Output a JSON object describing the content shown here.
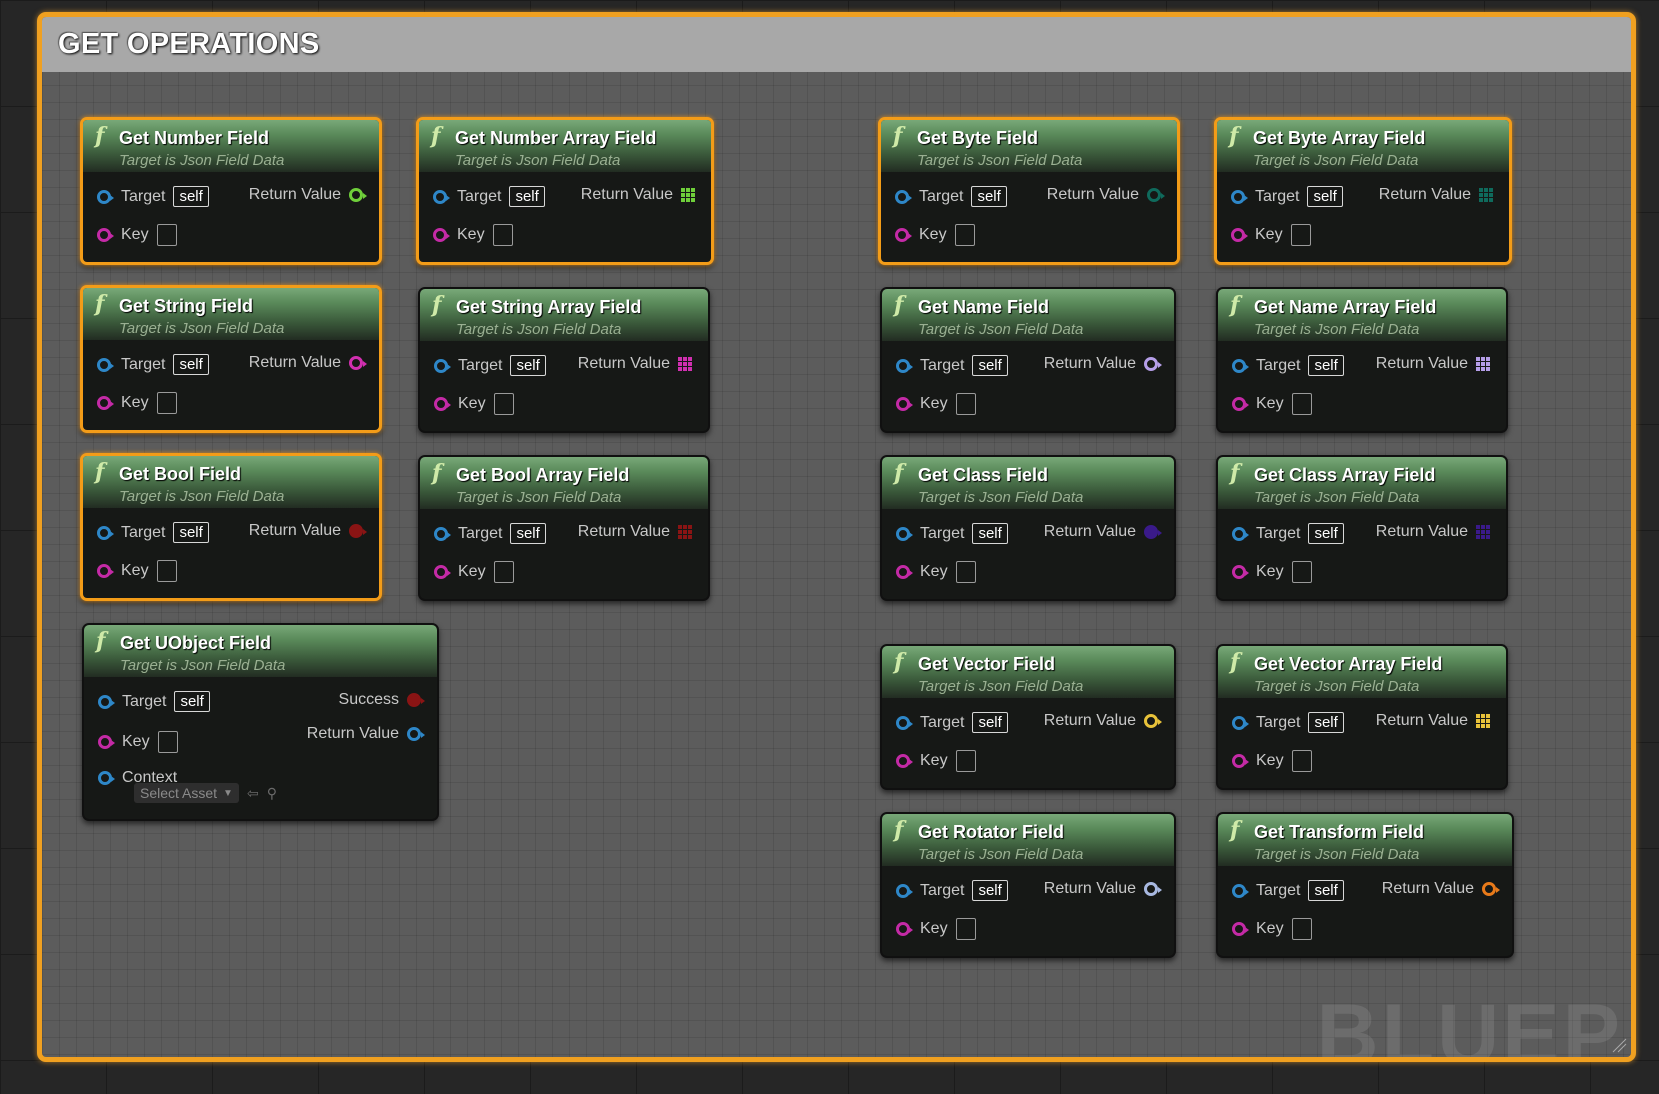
{
  "comment": {
    "title": "GET OPERATIONS",
    "watermark": "BLUEP"
  },
  "colors": {
    "comment_border": "#f0a020",
    "header_green": "#5a8a5a",
    "pin_blue": "#2e87c8",
    "pin_pink": "#c42aa6"
  },
  "common": {
    "subtitle": "Target is Json Field Data",
    "target_label": "Target",
    "self_label": "self",
    "key_label": "Key",
    "return_label": "Return Value"
  },
  "nodes": [
    {
      "title": "Get Number Field",
      "return_color": "#6fcf3a",
      "return_shape": "circle",
      "selected": true
    },
    {
      "title": "Get Number Array Field",
      "return_color": "#6fcf3a",
      "return_shape": "grid",
      "selected": true
    },
    {
      "title": "Get Byte Field",
      "return_color": "#0f6a5c",
      "return_shape": "circle",
      "selected": true
    },
    {
      "title": "Get Byte Array Field",
      "return_color": "#0f6a5c",
      "return_shape": "grid",
      "selected": true
    },
    {
      "title": "Get String Field",
      "return_color": "#d12fb0",
      "return_shape": "circle",
      "selected": true
    },
    {
      "title": "Get String Array Field",
      "return_color": "#d12fb0",
      "return_shape": "grid",
      "selected": false
    },
    {
      "title": "Get Name Field",
      "return_color": "#b59ee8",
      "return_shape": "circle",
      "selected": false
    },
    {
      "title": "Get Name Array Field",
      "return_color": "#b59ee8",
      "return_shape": "grid",
      "selected": false
    },
    {
      "title": "Get Bool Field",
      "return_color": "#8a1414",
      "return_shape": "circle-filled",
      "selected": true
    },
    {
      "title": "Get Bool Array Field",
      "return_color": "#8a1414",
      "return_shape": "grid",
      "selected": false
    },
    {
      "title": "Get Class Field",
      "return_color": "#3a1a8a",
      "return_shape": "circle-filled",
      "selected": false
    },
    {
      "title": "Get Class Array Field",
      "return_color": "#3a1a8a",
      "return_shape": "grid",
      "selected": false
    },
    {
      "title": "Get Vector Field",
      "return_color": "#e8c23a",
      "return_shape": "circle",
      "selected": false
    },
    {
      "title": "Get Vector Array Field",
      "return_color": "#e8c23a",
      "return_shape": "grid",
      "selected": false
    },
    {
      "title": "Get Rotator Field",
      "return_color": "#a8b8e0",
      "return_shape": "circle",
      "selected": false
    },
    {
      "title": "Get Transform Field",
      "return_color": "#e87a1a",
      "return_shape": "circle",
      "selected": false
    }
  ],
  "uobject_node": {
    "title": "Get UObject Field",
    "success_label": "Success",
    "success_color": "#8a1414",
    "return_color": "#2e87c8",
    "context_label": "Context",
    "select_asset": "Select Asset"
  }
}
